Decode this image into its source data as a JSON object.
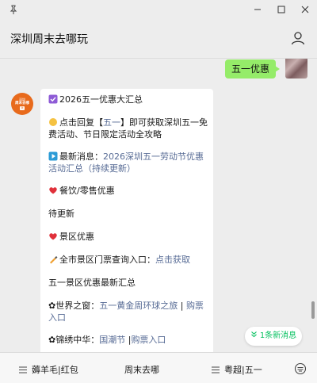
{
  "header": {
    "title": "深圳周末去哪玩"
  },
  "chat": {
    "sent_message": "五一优惠",
    "card": {
      "heading": "2026五一优惠大汇总",
      "reply_prefix": "点击回复【",
      "reply_keyword": "五一",
      "reply_suffix": "】即可获取深圳五一免费活动、节日限定活动全攻略",
      "latest_prefix": "最新消息：",
      "latest_link": "2026深圳五一劳动节优惠活动汇总（持续更新）",
      "food_title": "餐饮/零售优惠",
      "pending": "待更新",
      "scenic_title": "景区优惠",
      "ticket_prefix": "全市景区门票查询入口：",
      "ticket_link": "点击获取",
      "scenic_summary_link": "五一景区优惠最新汇总",
      "world_window_prefix": "✿世界之窗：",
      "world_window_link1": "五一黄金周环球之旅",
      "world_window_link2": "购票入口",
      "jinxiu_prefix": "✿锦绣中华：",
      "jinxiu_link1": "国潮节",
      "jinxiu_link2": "购票入口",
      "separator": "|"
    },
    "bot_avatar": {
      "line1": "深圳",
      "line2": "周末去哪",
      "line3": "玩"
    }
  },
  "new_message_badge": "1条新消息",
  "bottom_menu": {
    "items": [
      "薅羊毛|红包",
      "周末去哪",
      "粤超|五一"
    ]
  },
  "icons": [
    "pin-icon",
    "minimize-icon",
    "maximize-icon",
    "close-icon",
    "user-icon",
    "chevron-down-icon",
    "keyboard-icon"
  ],
  "colors": {
    "sent_bubble": "#95ec69",
    "link": "#576b95",
    "accent_green": "#07c160"
  }
}
